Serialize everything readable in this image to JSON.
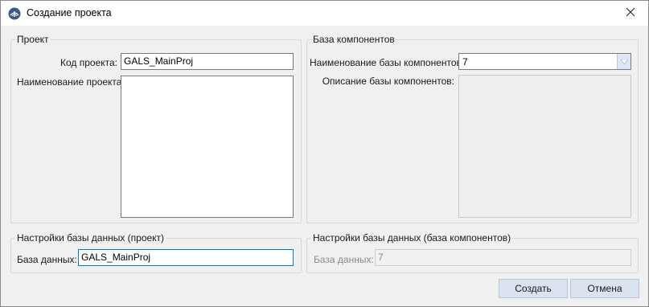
{
  "window": {
    "title": "Создание проекта",
    "app_icon": "globe-logo-icon",
    "close_icon": "close-icon"
  },
  "project_group": {
    "title": "Проект",
    "code_label": "Код проекта:",
    "code_value": "GALS_MainProj",
    "name_label": "Наименование проекта:",
    "name_value": ""
  },
  "component_base_group": {
    "title": "База компонентов",
    "name_label": "Наименование базы компонентов:",
    "name_selected": "7",
    "description_label": "Описание базы компонентов:",
    "description_value": ""
  },
  "db_project_group": {
    "title": "Настройки базы данных (проект)",
    "db_label": "База данных:",
    "db_value": "GALS_MainProj"
  },
  "db_components_group": {
    "title": "Настройки базы данных (база компонентов)",
    "db_label": "База данных:",
    "db_value": "7"
  },
  "buttons": {
    "create": "Создать",
    "cancel": "Отмена"
  },
  "colors": {
    "accent": "#0078d7",
    "button_bg": "#dce3f0"
  }
}
